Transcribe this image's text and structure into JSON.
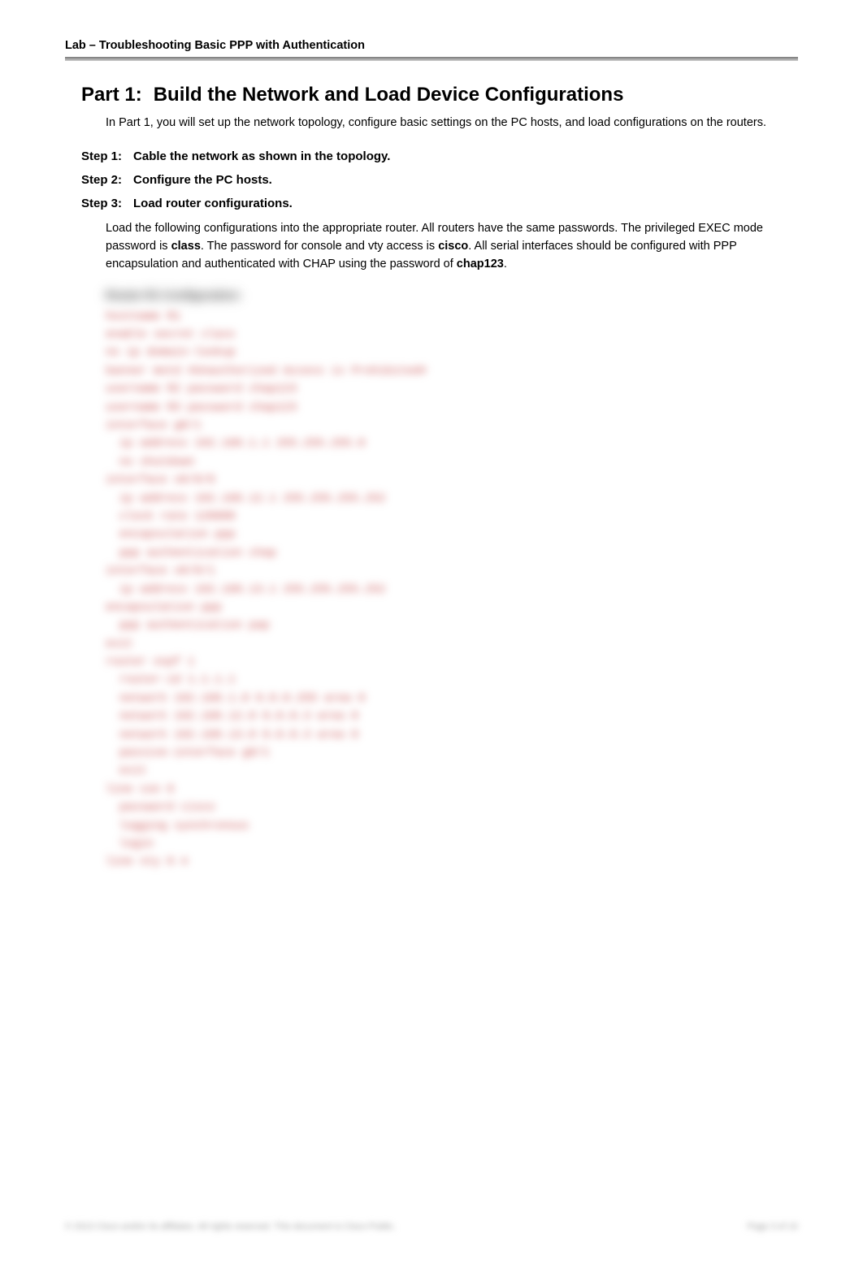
{
  "header": {
    "running": "Lab – Troubleshooting Basic PPP with Authentication"
  },
  "part": {
    "label": "Part 1:",
    "title": "Build the Network and Load Device Configurations",
    "intro": "In Part 1, you will set up the network topology, configure basic settings on the PC hosts, and load configurations on the routers."
  },
  "steps": {
    "s1": {
      "label": "Step 1:",
      "title": "Cable the network as shown in the topology."
    },
    "s2": {
      "label": "Step 2:",
      "title": "Configure the PC hosts."
    },
    "s3": {
      "label": "Step 3:",
      "title": "Load router configurations."
    }
  },
  "s3body": {
    "pre1": "Load the following configurations into the appropriate router. All routers have the same passwords. The privileged EXEC mode password is ",
    "b1": "class",
    "mid1": ". The password for console and vty access is ",
    "b2": "cisco",
    "mid2": ". All serial interfaces should be configured with PPP encapsulation and authenticated with CHAP using the password of ",
    "b3": "chap123",
    "post": "."
  },
  "blurred": {
    "heading": "Router R1 Configuration:",
    "lines": [
      "hostname R1",
      "enable secret class",
      "no ip domain-lookup",
      "banner motd #Unauthorized Access is Prohibited#",
      "username R2 password chap123",
      "username R3 password chap123",
      "interface g0/1",
      "  ip address 192.168.1.1 255.255.255.0",
      "  no shutdown",
      "interface s0/0/0",
      "  ip address 192.168.12.1 255.255.255.252",
      "  clock rate 128000",
      "  encapsulation ppp",
      "  ppp authentication chap",
      "interface s0/0/1",
      "  ip address 192.168.13.1 255.255.255.252",
      "encapsulation ppp",
      "  ppp authentication pap",
      "exit",
      "router ospf 1",
      "  router-id 1.1.1.1",
      "  network 192.168.1.0 0.0.0.255 area 0",
      "  network 192.168.12.0 0.0.0.3 area 0",
      "  network 192.168.13.0 0.0.0.3 area 0",
      "  passive-interface g0/1",
      "  exit",
      "line con 0",
      "  password cisco",
      "  logging synchronous",
      "  login",
      "line vty 0 4"
    ]
  },
  "footer": {
    "left": "© 2013 Cisco and/or its affiliates. All rights reserved. This document is Cisco Public.",
    "right": "Page 3 of 10"
  }
}
